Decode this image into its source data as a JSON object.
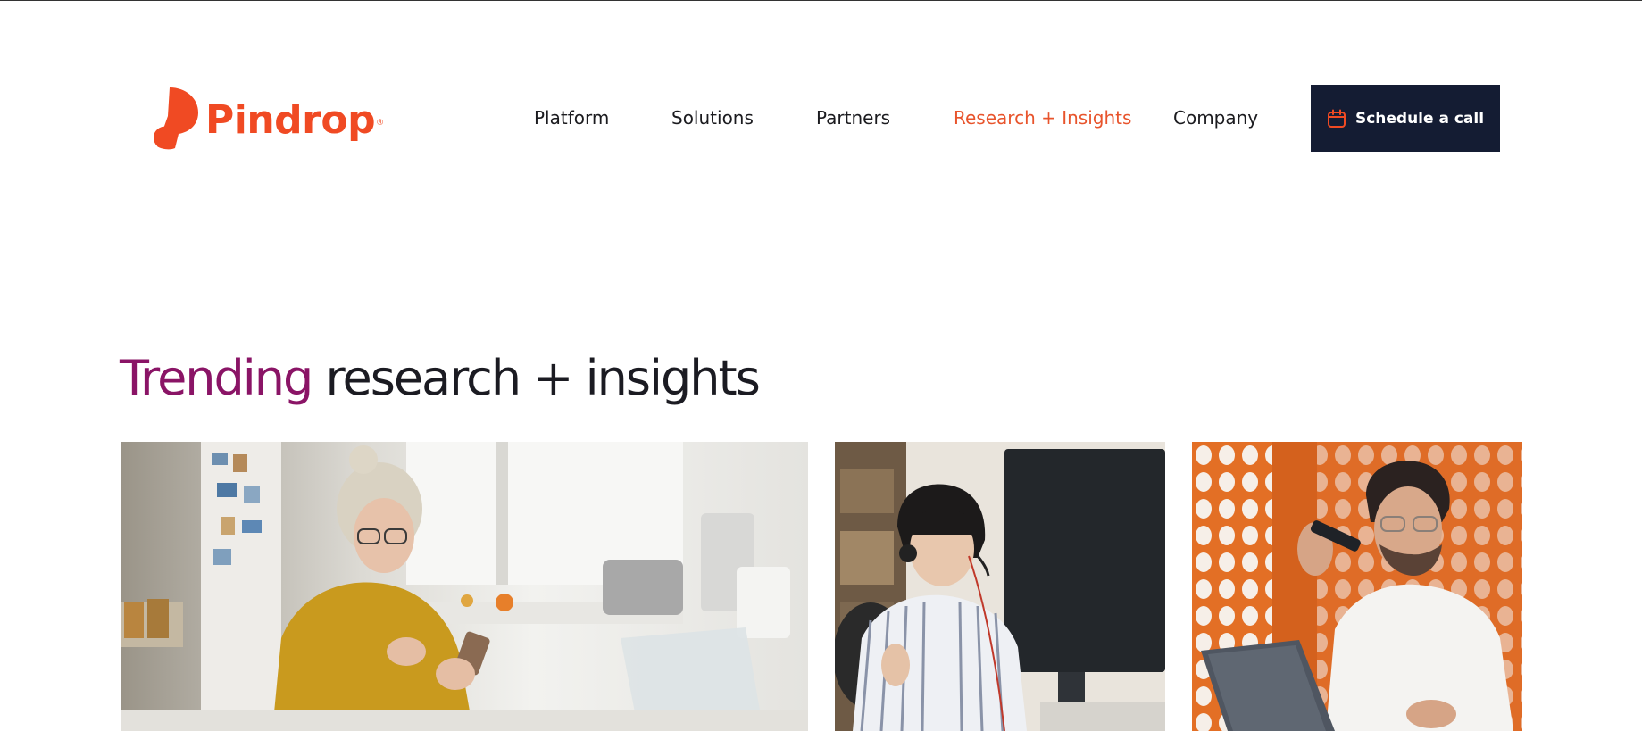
{
  "brand": {
    "name": "Pindrop",
    "registered": "®",
    "color": "#f04a23"
  },
  "nav": {
    "items": [
      {
        "label": "Platform",
        "active": false
      },
      {
        "label": "Solutions",
        "active": false
      },
      {
        "label": "Partners",
        "active": false
      },
      {
        "label": "Research + Insights",
        "active": true
      },
      {
        "label": "Company",
        "active": false
      }
    ],
    "active_color": "#e8542c"
  },
  "cta": {
    "label": "Schedule a call",
    "icon": "calendar-icon",
    "background": "#141c33"
  },
  "section": {
    "title_accent": "Trending",
    "title_rest": " research + insights",
    "accent_color": "#8a1466"
  },
  "cards": [
    {
      "image": "woman-in-kitchen-with-phone-photo"
    },
    {
      "image": "agent-with-headset-at-monitor-photo"
    },
    {
      "image": "man-speaking-into-phone-at-laptop-photo"
    }
  ]
}
